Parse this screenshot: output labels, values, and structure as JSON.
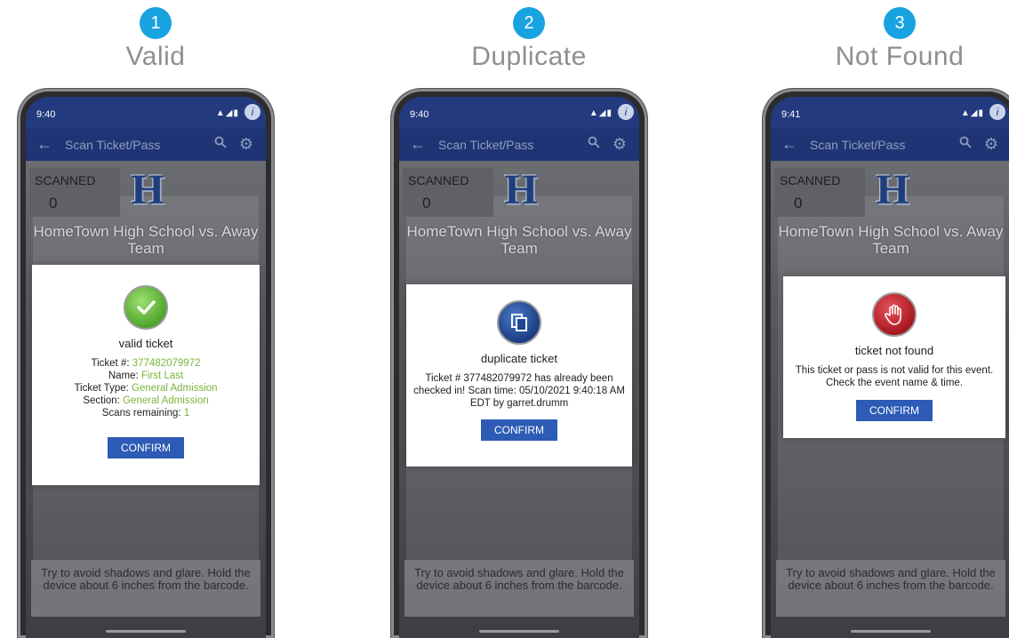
{
  "steps": [
    {
      "number": "1",
      "title": "Valid",
      "phone": {
        "time": "9:40",
        "app_title": "Scan Ticket/Pass",
        "scanned_label": "SCANNED",
        "scanned_count": "0",
        "event_name": "HomeTown High School vs. Away Team",
        "dialog": {
          "icon": "check-icon",
          "title": "valid ticket",
          "ticket_label": "Ticket #:",
          "ticket_value": "377482079972",
          "name_label": "Name:",
          "name_value": "First Last",
          "type_label": "Ticket Type:",
          "type_value": "General Admission",
          "section_label": "Section:",
          "section_value": "General Admission",
          "scans_label": "Scans remaining:",
          "scans_value": "1",
          "confirm": "CONFIRM"
        },
        "hint": "Try to avoid shadows and glare. Hold the device about 6 inches from the barcode."
      }
    },
    {
      "number": "2",
      "title": "Duplicate",
      "phone": {
        "time": "9:40",
        "app_title": "Scan Ticket/Pass",
        "scanned_label": "SCANNED",
        "scanned_count": "0",
        "event_name": "HomeTown High School vs. Away Team",
        "dialog": {
          "icon": "copy-icon",
          "title": "duplicate ticket",
          "message": "Ticket # 377482079972 has already been checked in! Scan time: 05/10/2021 9:40:18 AM EDT by garret.drumm",
          "confirm": "CONFIRM"
        },
        "hint": "Try to avoid shadows and glare. Hold the device about 6 inches from the barcode."
      }
    },
    {
      "number": "3",
      "title": "Not Found",
      "phone": {
        "time": "9:41",
        "app_title": "Scan Ticket/Pass",
        "scanned_label": "SCANNED",
        "scanned_count": "0",
        "event_name": "HomeTown High School vs. Away Team",
        "dialog": {
          "icon": "hand-stop-icon",
          "title": "ticket not found",
          "message": "This ticket or pass is not valid for this event. Check the event name & time.",
          "confirm": "CONFIRM"
        },
        "hint": "Try to avoid shadows and glare. Hold the device about 6 inches from the barcode."
      }
    }
  ],
  "logo_letter": "H",
  "colors": {
    "step_badge": "#19a2e0",
    "app_bar": "#1f3474",
    "confirm_button": "#2d5bb5",
    "valid_green": "#79b43a",
    "error_red": "#c8232c"
  }
}
